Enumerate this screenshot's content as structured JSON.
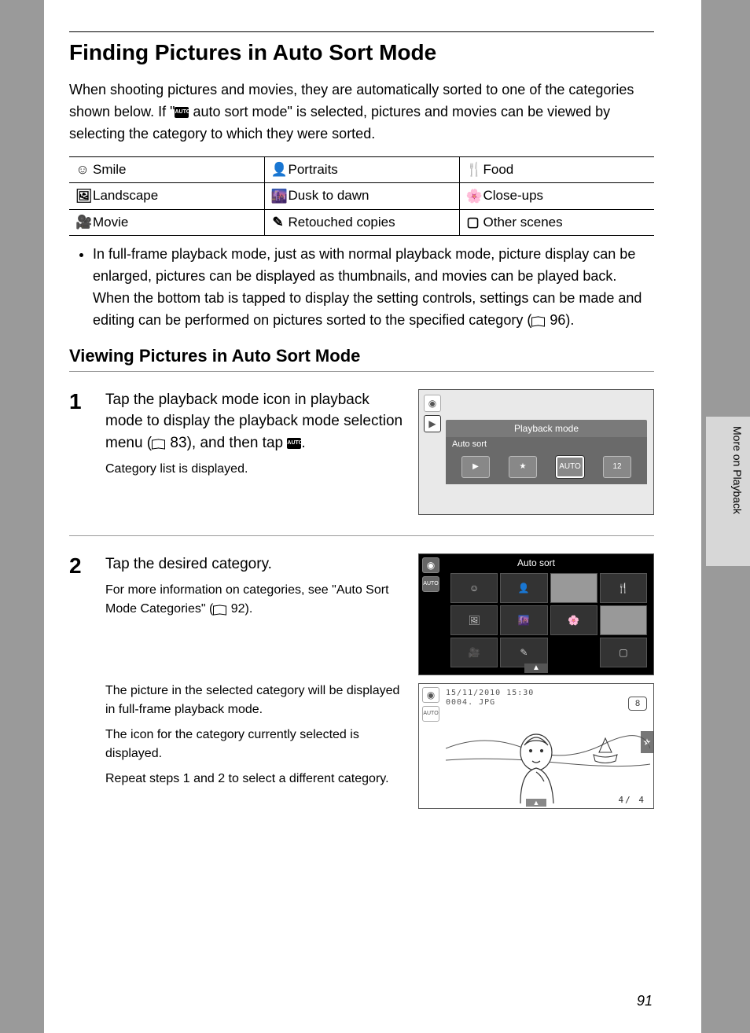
{
  "title": "Finding Pictures in Auto Sort Mode",
  "intro_part1": "When shooting pictures and movies, they are automatically sorted to one of the categories shown below. If \"",
  "intro_icon_text": "AUTO",
  "intro_part2": " auto sort mode\" is selected, pictures and movies can be viewed by selecting the category to which they were sorted.",
  "categories": [
    [
      {
        "icon": "☺",
        "label": "Smile"
      },
      {
        "icon": "👤",
        "label": "Portraits"
      },
      {
        "icon": "🍴",
        "label": "Food"
      }
    ],
    [
      {
        "icon": "🖼",
        "label": "Landscape"
      },
      {
        "icon": "🌆",
        "label": "Dusk to dawn"
      },
      {
        "icon": "🌸",
        "label": "Close-ups"
      }
    ],
    [
      {
        "icon": "🎥",
        "label": "Movie"
      },
      {
        "icon": "✎",
        "label": "Retouched copies"
      },
      {
        "icon": "▢",
        "label": "Other scenes"
      }
    ]
  ],
  "note": {
    "part1": "In full-frame playback mode, just as with normal playback mode, picture display can be enlarged, pictures can be displayed as thumbnails, and movies can be played back. When the bottom tab is tapped to display the setting controls, settings can be made and editing can be performed on pictures sorted to the specified category (",
    "ref": "96",
    "part2": ")."
  },
  "subtitle": "Viewing Pictures in Auto Sort Mode",
  "step1": {
    "num": "1",
    "main_part1": "Tap the playback mode icon in playback mode to display the playback mode selection menu (",
    "main_ref": "83",
    "main_part2": "), and then tap ",
    "main_icon": "AUTO",
    "main_part3": ".",
    "sub": "Category list is displayed.",
    "screen": {
      "title": "Playback mode",
      "subtitle": "Auto sort",
      "modes": [
        "▶",
        "★",
        "AUTO",
        "12"
      ]
    }
  },
  "step2": {
    "num": "2",
    "main": "Tap the desired category.",
    "sub1_part1": "For more information on categories, see \"Auto Sort Mode Categories\" (",
    "sub1_ref": "92",
    "sub1_part2": ").",
    "sub2": "The picture in the selected category will be displayed in full-frame playback mode.",
    "sub3": "The icon for the category currently selected is displayed.",
    "sub4": "Repeat steps 1 and 2 to select a different category.",
    "screen_grid": {
      "title": "Auto sort"
    },
    "screen_full": {
      "date": "15/11/2010 15:30",
      "file": "0004. JPG",
      "badge": "8",
      "counter": "4/  4"
    }
  },
  "side_tab": "More on Playback",
  "page_number": "91"
}
